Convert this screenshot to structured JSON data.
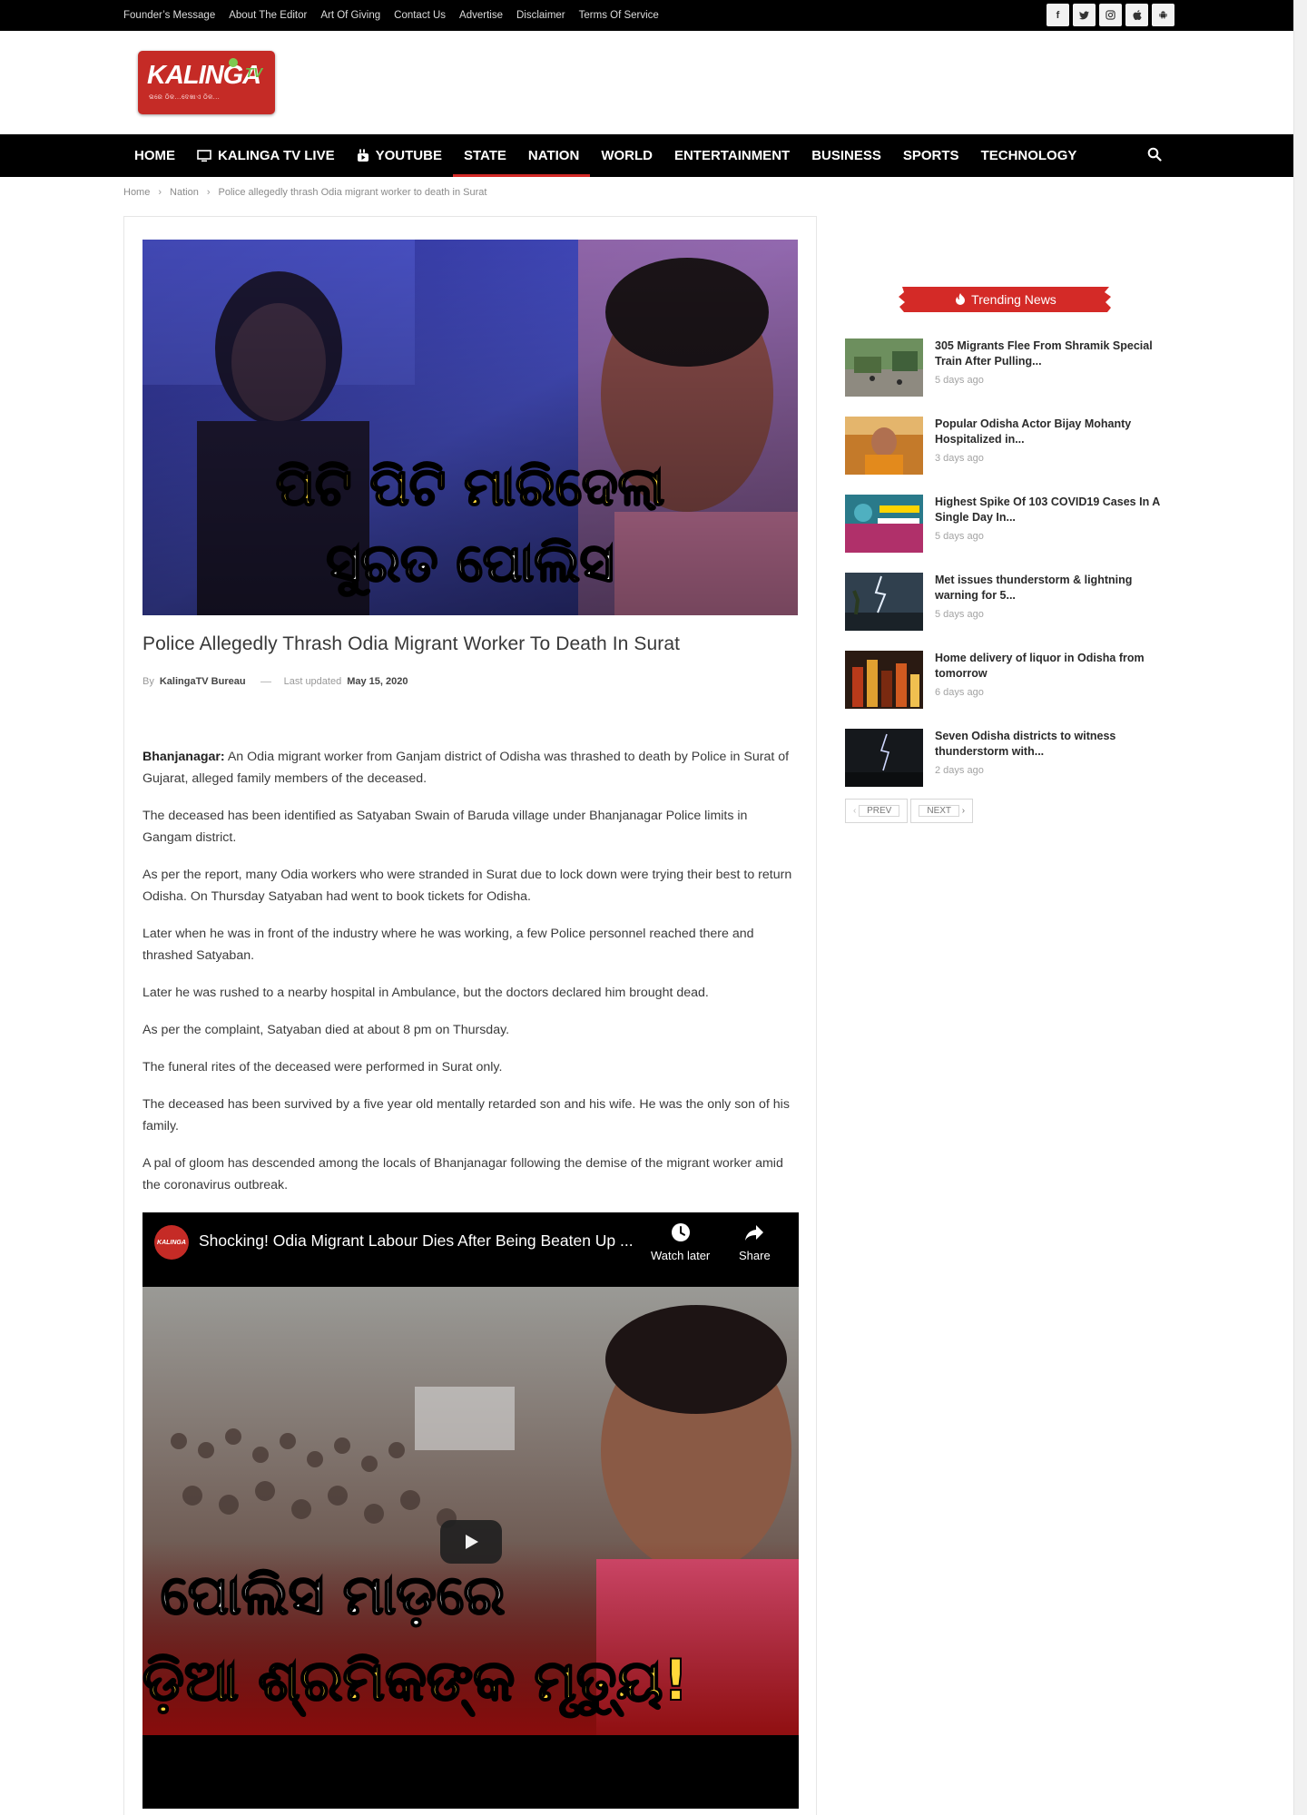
{
  "topbar": {
    "links": [
      "Founder’s Message",
      "About The Editor",
      "Art Of Giving",
      "Contact Us",
      "Advertise",
      "Disclaimer",
      "Terms Of Service"
    ],
    "social": [
      "f",
      "t",
      "ig",
      "ios",
      "android"
    ]
  },
  "logo": {
    "word": "KALINGA",
    "suffix": "TV",
    "tagline": "ଭରେ ଠିକ...ଦେଖାଏ ଠିକ..."
  },
  "nav": {
    "items": [
      "HOME",
      "KALINGA TV LIVE",
      "YOUTUBE",
      "STATE",
      "NATION",
      "WORLD",
      "ENTERTAINMENT",
      "BUSINESS",
      "SPORTS",
      "TECHNOLOGY"
    ]
  },
  "breadcrumb": [
    "Home",
    "Nation",
    "Police allegedly thrash Odia migrant worker to death in Surat"
  ],
  "article": {
    "hero_caption_line1": "ପିଟି ପିଟି ମାରିଦେଲା",
    "hero_caption_line2": "ସୁରତ ପୋଲିସ",
    "title": "Police Allegedly Thrash Odia Migrant Worker To Death In Surat",
    "by_label": "By",
    "author": "KalingaTV Bureau",
    "updated_label": "Last updated",
    "updated_date": "May 15, 2020",
    "lead_place": "Bhanjanagar:",
    "paragraphs": [
      " An Odia migrant worker from Ganjam district of Odisha was thrashed to death by Police in Surat of Gujarat, alleged family members of the deceased.",
      "The deceased has been identified as Satyaban Swain of Baruda village under Bhanjanagar Police limits in Gangam district.",
      "As per the report, many Odia workers who were stranded in Surat due to lock down were trying their best to return Odisha. On Thursday Satyaban had went to book tickets for Odisha.",
      "Later when he was in front of the industry where he was working, a few Police personnel reached there and thrashed Satyaban.",
      "Later he was rushed to a nearby hospital in Ambulance, but the doctors declared him brought dead.",
      "As per the complaint, Satyaban died at about 8 pm on Thursday.",
      "The funeral rites of the deceased were performed in Surat only.",
      "The deceased has been survived by a five year old mentally retarded son and his wife. He was the only son of his family.",
      "A pal of gloom has descended among the locals of Bhanjanagar following the demise of the migrant worker amid the coronavirus outbreak."
    ]
  },
  "video": {
    "channel": "KALINGA",
    "title": "Shocking! Odia Migrant Labour Dies After Being Beaten Up ...",
    "watch_later": "Watch later",
    "share": "Share",
    "caption_line1": "ପୋଲିସ ମାଡ଼ରେ",
    "caption_line2": "ଡ଼ିଆ ଶ୍ରମିକଙ୍କ ମୃତ୍ୟୁ!"
  },
  "sidebar": {
    "heading": "Trending News",
    "items": [
      {
        "title": "305 Migrants Flee From Shramik Special Train After Pulling...",
        "ago": "5 days ago"
      },
      {
        "title": "Popular Odisha Actor Bijay Mohanty Hospitalized in...",
        "ago": "3 days ago"
      },
      {
        "title": "Highest Spike Of 103 COVID19 Cases In A Single Day In...",
        "ago": "5 days ago"
      },
      {
        "title": "Met issues thunderstorm & lightning warning for 5...",
        "ago": "5 days ago"
      },
      {
        "title": "Home delivery of liquor in Odisha from tomorrow",
        "ago": "6 days ago"
      },
      {
        "title": "Seven Odisha districts to witness thunderstorm with...",
        "ago": "2 days ago"
      }
    ],
    "prev": "PREV",
    "next": "NEXT"
  },
  "colors": {
    "brand_red": "#d42a27",
    "topbar": "#000000",
    "nav": "#000000"
  }
}
